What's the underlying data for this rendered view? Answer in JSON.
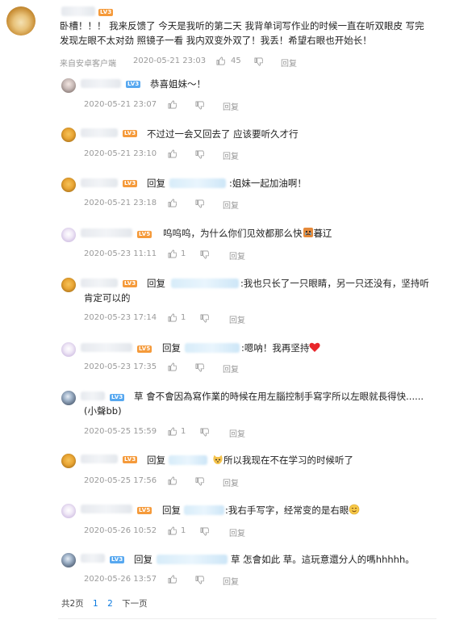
{
  "top_comment": {
    "name_badge": "LV3",
    "text_line1": "卧槽！！！ 我来反馈了 今天是我听的第二天 我背单词写作业的时候一直在听双眼皮 写完",
    "text_line2": "发现左眼不太对劲 照镜子一看 我内双变外双了！我丢！希望右眼也开始长！",
    "source": "来自安卓客户端",
    "time": "2020-05-21 23:03",
    "likes": "45",
    "reply_label": "回复"
  },
  "replies": [
    {
      "badge": "LV3",
      "text": "恭喜姐妹～！",
      "time": "2020-05-21 23:07",
      "likes": "",
      "reply_label": "回复"
    },
    {
      "badge": "LV3",
      "text": "不过过一会又回去了 应该要听久才行",
      "time": "2020-05-21 23:10",
      "likes": "",
      "reply_label": "回复"
    },
    {
      "badge": "LV3",
      "prefix": "回复",
      "text": ":姐妹一起加油啊！",
      "time": "2020-05-21 23:18",
      "likes": "",
      "reply_label": "回复"
    },
    {
      "badge": "LV5",
      "text": "呜呜呜，为什么你们见效都那么快",
      "tail": "暮辽",
      "time": "2020-05-23 11:11",
      "likes": "1",
      "reply_label": "回复"
    },
    {
      "badge": "LV3",
      "prefix": "回复",
      "text": ":我也只长了一只眼睛，另一只还没有，坚持听",
      "text2": "肯定可以的",
      "time": "2020-05-23 17:14",
      "likes": "1",
      "reply_label": "回复"
    },
    {
      "badge": "LV5",
      "prefix": "回复",
      "text": ":嗯呐！我再坚持",
      "time": "2020-05-23 17:35",
      "likes": "",
      "reply_label": "回复"
    },
    {
      "badge": "LV3",
      "text": "草  會不會因為寫作業的時候在用左腦控制手寫字所以左眼就長得快......",
      "text2": "(小聲bb)",
      "time": "2020-05-25 15:59",
      "likes": "1",
      "reply_label": "回复"
    },
    {
      "badge": "LV3",
      "prefix": "回复",
      "text": "所以我现在不在学习的时候听了",
      "time": "2020-05-25 17:56",
      "likes": "",
      "reply_label": "回复"
    },
    {
      "badge": "LV5",
      "prefix": "回复",
      "text": ":我右手写字，经常变的是右眼",
      "time": "2020-05-26 10:52",
      "likes": "1",
      "reply_label": "回复"
    },
    {
      "badge": "LV3",
      "prefix": "回复",
      "text": "草  怎會如此  草。這玩意還分人的嗎hhhhh。",
      "time": "2020-05-26 13:57",
      "likes": "",
      "reply_label": "回复"
    }
  ],
  "pager": {
    "total": "共2页",
    "page1": "1",
    "page2": "2",
    "next": "下一页"
  },
  "colors": {
    "accent": "#0d7be0",
    "muted": "#9a9a9a",
    "badge_orange": "#f59a3a",
    "badge_blue": "#57a8f0"
  }
}
